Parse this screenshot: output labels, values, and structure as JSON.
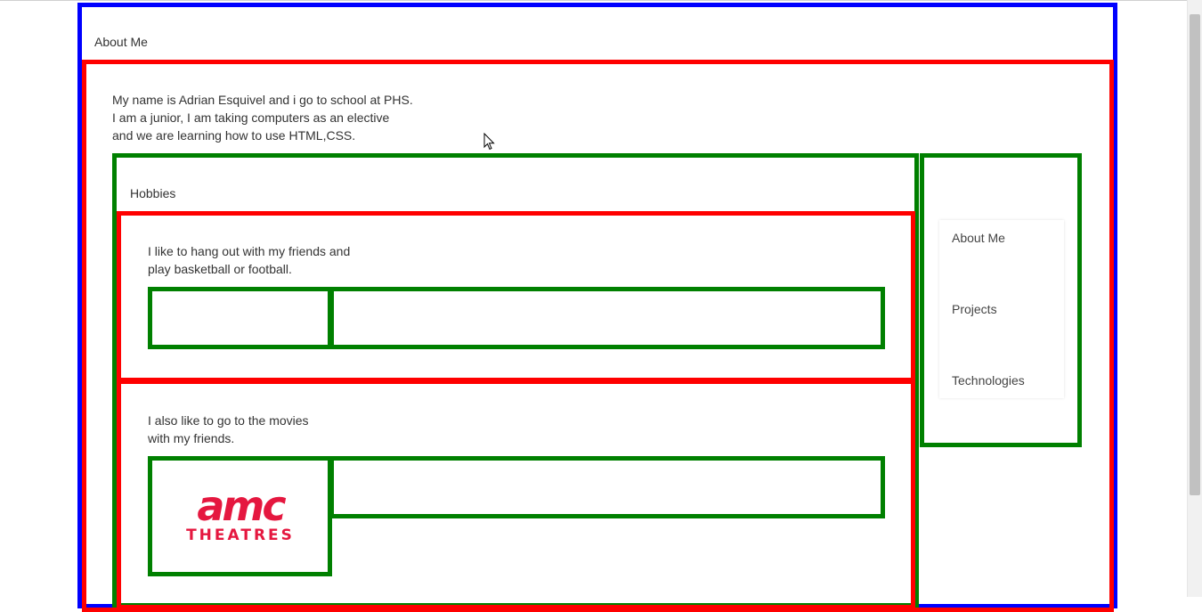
{
  "header": {
    "title": "About Me"
  },
  "intro": {
    "lines": [
      "My name is Adrian Esquivel and i go to school at PHS.",
      "I am a junior, I am taking computers as an elective",
      "and we are learning how to use HTML,CSS."
    ]
  },
  "hobbies": {
    "title": "Hobbies",
    "items": [
      {
        "lines": [
          "I like to hang out with my friends and",
          "play basketball or football."
        ]
      },
      {
        "lines": [
          "I also like to go to the movies",
          "with my friends."
        ],
        "logo": {
          "word": "amc",
          "sub": "THEATRES"
        }
      }
    ]
  },
  "sidebar": {
    "items": [
      {
        "label": "About Me"
      },
      {
        "label": "Projects"
      },
      {
        "label": "Technologies"
      }
    ]
  },
  "colors": {
    "outer_border": "#0000ff",
    "section_border": "#ff0000",
    "inner_border": "#008000",
    "logo_red": "#e5173f"
  }
}
